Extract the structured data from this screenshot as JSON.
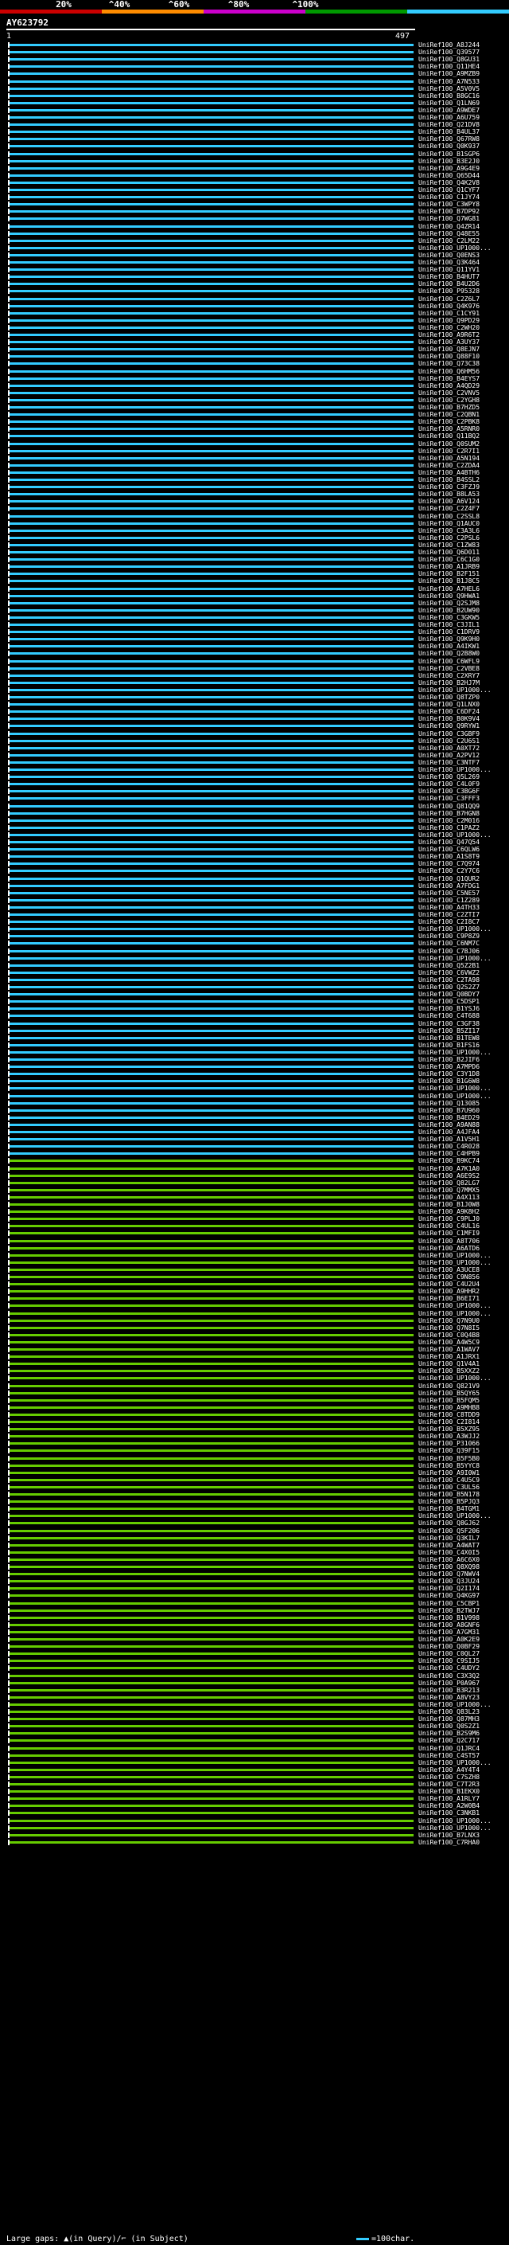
{
  "scale": {
    "ticks": [
      "20%",
      "^40%",
      "^60%",
      "^80%",
      "^100%"
    ],
    "colors": [
      "#cc0000",
      "#ff8c00",
      "#cc00cc",
      "#009900",
      "#33ccff"
    ]
  },
  "title": "AY623792",
  "query_start": "1",
  "query_end": "497",
  "colors": {
    "cyan": "#33ccff",
    "green": "#66cc00"
  },
  "hits": [
    {
      "label": "UniRef100_A8J244",
      "color": "cyan"
    },
    {
      "label": "UniRef100_Q39577",
      "color": "cyan"
    },
    {
      "label": "UniRef100_Q8GU31",
      "color": "cyan"
    },
    {
      "label": "UniRef100_Q11HE4",
      "color": "cyan"
    },
    {
      "label": "UniRef100_A9MZB9",
      "color": "cyan"
    },
    {
      "label": "UniRef100_A7N533",
      "color": "cyan"
    },
    {
      "label": "UniRef100_A5V0V5",
      "color": "cyan"
    },
    {
      "label": "UniRef100_B8GC16",
      "color": "cyan"
    },
    {
      "label": "UniRef100_Q1LN69",
      "color": "cyan"
    },
    {
      "label": "UniRef100_A9WDE7",
      "color": "cyan"
    },
    {
      "label": "UniRef100_A6U759",
      "color": "cyan"
    },
    {
      "label": "UniRef100_Q21DV8",
      "color": "cyan"
    },
    {
      "label": "UniRef100_B4UL37",
      "color": "cyan"
    },
    {
      "label": "UniRef100_Q67RW8",
      "color": "cyan"
    },
    {
      "label": "UniRef100_Q0K937",
      "color": "cyan"
    },
    {
      "label": "UniRef100_B1SGP6",
      "color": "cyan"
    },
    {
      "label": "UniRef100_B3E2J0",
      "color": "cyan"
    },
    {
      "label": "UniRef100_A9G4E9",
      "color": "cyan"
    },
    {
      "label": "UniRef100_Q65D44",
      "color": "cyan"
    },
    {
      "label": "UniRef100_Q4K2V8",
      "color": "cyan"
    },
    {
      "label": "UniRef100_Q1CYF7",
      "color": "cyan"
    },
    {
      "label": "UniRef100_C1JY74",
      "color": "cyan"
    },
    {
      "label": "UniRef100_C3WPY8",
      "color": "cyan"
    },
    {
      "label": "UniRef100_B7DP92",
      "color": "cyan"
    },
    {
      "label": "UniRef100_Q7WG81",
      "color": "cyan"
    },
    {
      "label": "UniRef100_Q4ZR14",
      "color": "cyan"
    },
    {
      "label": "UniRef100_Q48E55",
      "color": "cyan"
    },
    {
      "label": "UniRef100_C2LM22",
      "color": "cyan"
    },
    {
      "label": "UniRef100_UP1000...",
      "color": "cyan"
    },
    {
      "label": "UniRef100_Q0ENS3",
      "color": "cyan"
    },
    {
      "label": "UniRef100_Q3K464",
      "color": "cyan"
    },
    {
      "label": "UniRef100_Q11YV1",
      "color": "cyan"
    },
    {
      "label": "UniRef100_B4HUT7",
      "color": "cyan"
    },
    {
      "label": "UniRef100_B4U2D6",
      "color": "cyan"
    },
    {
      "label": "UniRef100_P95328",
      "color": "cyan"
    },
    {
      "label": "UniRef100_C2Z6L7",
      "color": "cyan"
    },
    {
      "label": "UniRef100_Q4K976",
      "color": "cyan"
    },
    {
      "label": "UniRef100_C1CY91",
      "color": "cyan"
    },
    {
      "label": "UniRef100_Q9PD29",
      "color": "cyan"
    },
    {
      "label": "UniRef100_C2WH20",
      "color": "cyan"
    },
    {
      "label": "UniRef100_A9R6T2",
      "color": "cyan"
    },
    {
      "label": "UniRef100_A3UY37",
      "color": "cyan"
    },
    {
      "label": "UniRef100_Q8EJN7",
      "color": "cyan"
    },
    {
      "label": "UniRef100_Q88F10",
      "color": "cyan"
    },
    {
      "label": "UniRef100_Q73C38",
      "color": "cyan"
    },
    {
      "label": "UniRef100_Q6HM56",
      "color": "cyan"
    },
    {
      "label": "UniRef100_B4EYS7",
      "color": "cyan"
    },
    {
      "label": "UniRef100_A4QD29",
      "color": "cyan"
    },
    {
      "label": "UniRef100_C2VNV5",
      "color": "cyan"
    },
    {
      "label": "UniRef100_C2YGH8",
      "color": "cyan"
    },
    {
      "label": "UniRef100_B7HZD5",
      "color": "cyan"
    },
    {
      "label": "UniRef100_C2QBN1",
      "color": "cyan"
    },
    {
      "label": "UniRef100_C2PBK8",
      "color": "cyan"
    },
    {
      "label": "UniRef100_A5RNR0",
      "color": "cyan"
    },
    {
      "label": "UniRef100_Q11BQ2",
      "color": "cyan"
    },
    {
      "label": "UniRef100_Q0SUM2",
      "color": "cyan"
    },
    {
      "label": "UniRef100_C2R7I1",
      "color": "cyan"
    },
    {
      "label": "UniRef100_A5N194",
      "color": "cyan"
    },
    {
      "label": "UniRef100_C2ZDA4",
      "color": "cyan"
    },
    {
      "label": "UniRef100_A4BTH6",
      "color": "cyan"
    },
    {
      "label": "UniRef100_B4SSL2",
      "color": "cyan"
    },
    {
      "label": "UniRef100_C3FZJ9",
      "color": "cyan"
    },
    {
      "label": "UniRef100_B8LA53",
      "color": "cyan"
    },
    {
      "label": "UniRef100_A6V124",
      "color": "cyan"
    },
    {
      "label": "UniRef100_C2Z4F7",
      "color": "cyan"
    },
    {
      "label": "UniRef100_C2SSL8",
      "color": "cyan"
    },
    {
      "label": "UniRef100_Q1AUC0",
      "color": "cyan"
    },
    {
      "label": "UniRef100_C3A3L6",
      "color": "cyan"
    },
    {
      "label": "UniRef100_C2PSL6",
      "color": "cyan"
    },
    {
      "label": "UniRef100_C1ZW83",
      "color": "cyan"
    },
    {
      "label": "UniRef100_Q6D011",
      "color": "cyan"
    },
    {
      "label": "UniRef100_C6C1G0",
      "color": "cyan"
    },
    {
      "label": "UniRef100_A1JRB9",
      "color": "cyan"
    },
    {
      "label": "UniRef100_B2F151",
      "color": "cyan"
    },
    {
      "label": "UniRef100_B1J8C5",
      "color": "cyan"
    },
    {
      "label": "UniRef100_A7HEL6",
      "color": "cyan"
    },
    {
      "label": "UniRef100_Q9HWA1",
      "color": "cyan"
    },
    {
      "label": "UniRef100_Q2SJM8",
      "color": "cyan"
    },
    {
      "label": "UniRef100_B2UW90",
      "color": "cyan"
    },
    {
      "label": "UniRef100_C3GKW5",
      "color": "cyan"
    },
    {
      "label": "UniRef100_C3JIL1",
      "color": "cyan"
    },
    {
      "label": "UniRef100_C1DRV9",
      "color": "cyan"
    },
    {
      "label": "UniRef100_Q9K9H0",
      "color": "cyan"
    },
    {
      "label": "UniRef100_A4IKW1",
      "color": "cyan"
    },
    {
      "label": "UniRef100_Q2B8W0",
      "color": "cyan"
    },
    {
      "label": "UniRef100_C6WFL9",
      "color": "cyan"
    },
    {
      "label": "UniRef100_C2VBE8",
      "color": "cyan"
    },
    {
      "label": "UniRef100_C2XRY7",
      "color": "cyan"
    },
    {
      "label": "UniRef100_B2HJ7M",
      "color": "cyan"
    },
    {
      "label": "UniRef100_UP1000...",
      "color": "cyan"
    },
    {
      "label": "UniRef100_Q8TZP0",
      "color": "cyan"
    },
    {
      "label": "UniRef100_Q1LNX0",
      "color": "cyan"
    },
    {
      "label": "UniRef100_C6DF24",
      "color": "cyan"
    },
    {
      "label": "UniRef100_B0K9V4",
      "color": "cyan"
    },
    {
      "label": "UniRef100_Q9RYW1",
      "color": "cyan"
    },
    {
      "label": "UniRef100_C3GBF9",
      "color": "cyan"
    },
    {
      "label": "UniRef100_C2U6S1",
      "color": "cyan"
    },
    {
      "label": "UniRef100_A0XT72",
      "color": "cyan"
    },
    {
      "label": "UniRef100_A2PV12",
      "color": "cyan"
    },
    {
      "label": "UniRef100_C3NTF7",
      "color": "cyan"
    },
    {
      "label": "UniRef100_UP1000...",
      "color": "cyan"
    },
    {
      "label": "UniRef100_Q5L269",
      "color": "cyan"
    },
    {
      "label": "UniRef100_C4L0F9",
      "color": "cyan"
    },
    {
      "label": "UniRef100_C3BG6F",
      "color": "cyan"
    },
    {
      "label": "UniRef100_C3FFF3",
      "color": "cyan"
    },
    {
      "label": "UniRef100_Q81QQ9",
      "color": "cyan"
    },
    {
      "label": "UniRef100_B7HGN8",
      "color": "cyan"
    },
    {
      "label": "UniRef100_C2M016",
      "color": "cyan"
    },
    {
      "label": "UniRef100_C1PAZ2",
      "color": "cyan"
    },
    {
      "label": "UniRef100_UP1000...",
      "color": "cyan"
    },
    {
      "label": "UniRef100_Q47Q54",
      "color": "cyan"
    },
    {
      "label": "UniRef100_C6QLW6",
      "color": "cyan"
    },
    {
      "label": "UniRef100_A1S8T9",
      "color": "cyan"
    },
    {
      "label": "UniRef100_C7Q974",
      "color": "cyan"
    },
    {
      "label": "UniRef100_C2Y7C6",
      "color": "cyan"
    },
    {
      "label": "UniRef100_Q1QUR2",
      "color": "cyan"
    },
    {
      "label": "UniRef100_A7FDG1",
      "color": "cyan"
    },
    {
      "label": "UniRef100_C5NE57",
      "color": "cyan"
    },
    {
      "label": "UniRef100_C1Z289",
      "color": "cyan"
    },
    {
      "label": "UniRef100_A4TH33",
      "color": "cyan"
    },
    {
      "label": "UniRef100_C2ZTI7",
      "color": "cyan"
    },
    {
      "label": "UniRef100_C2I8C7",
      "color": "cyan"
    },
    {
      "label": "UniRef100_UP1000...",
      "color": "cyan"
    },
    {
      "label": "UniRef100_C9P8Z9",
      "color": "cyan"
    },
    {
      "label": "UniRef100_C6NM7C",
      "color": "cyan"
    },
    {
      "label": "UniRef100_C7BJ06",
      "color": "cyan"
    },
    {
      "label": "UniRef100_UP1000...",
      "color": "cyan"
    },
    {
      "label": "UniRef100_Q5Z2B1",
      "color": "cyan"
    },
    {
      "label": "UniRef100_C6VWZ2",
      "color": "cyan"
    },
    {
      "label": "UniRef100_C2TA98",
      "color": "cyan"
    },
    {
      "label": "UniRef100_Q2S2Z7",
      "color": "cyan"
    },
    {
      "label": "UniRef100_Q0BDY7",
      "color": "cyan"
    },
    {
      "label": "UniRef100_C5DSP1",
      "color": "cyan"
    },
    {
      "label": "UniRef100_B1YSJ6",
      "color": "cyan"
    },
    {
      "label": "UniRef100_C4T688",
      "color": "cyan"
    },
    {
      "label": "UniRef100_C3GF38",
      "color": "cyan"
    },
    {
      "label": "UniRef100_B5ZI17",
      "color": "cyan"
    },
    {
      "label": "UniRef100_B1TEW8",
      "color": "cyan"
    },
    {
      "label": "UniRef100_B1FS16",
      "color": "cyan"
    },
    {
      "label": "UniRef100_UP1000...",
      "color": "cyan"
    },
    {
      "label": "UniRef100_B2JIF6",
      "color": "cyan"
    },
    {
      "label": "UniRef100_A7MPD6",
      "color": "cyan"
    },
    {
      "label": "UniRef100_C3Y1D8",
      "color": "cyan"
    },
    {
      "label": "UniRef100_B1G6W8",
      "color": "cyan"
    },
    {
      "label": "UniRef100_UP1000...",
      "color": "cyan"
    },
    {
      "label": "UniRef100_UP1000...",
      "color": "cyan"
    },
    {
      "label": "UniRef100_Q13085",
      "color": "cyan"
    },
    {
      "label": "UniRef100_B7U960",
      "color": "cyan"
    },
    {
      "label": "UniRef100_B4ED29",
      "color": "cyan"
    },
    {
      "label": "UniRef100_A9AN88",
      "color": "cyan"
    },
    {
      "label": "UniRef100_A4JFA4",
      "color": "cyan"
    },
    {
      "label": "UniRef100_A1V5H1",
      "color": "cyan"
    },
    {
      "label": "UniRef100_C4R028",
      "color": "cyan"
    },
    {
      "label": "UniRef100_C4HPB9",
      "color": "cyan"
    },
    {
      "label": "UniRef100_B9KC74",
      "color": "green"
    },
    {
      "label": "UniRef100_A7K1A0",
      "color": "green"
    },
    {
      "label": "UniRef100_A6E9S2",
      "color": "green"
    },
    {
      "label": "UniRef100_Q82LG7",
      "color": "green"
    },
    {
      "label": "UniRef100_Q7MMX5",
      "color": "green"
    },
    {
      "label": "UniRef100_A4X113",
      "color": "green"
    },
    {
      "label": "UniRef100_B1J0W8",
      "color": "green"
    },
    {
      "label": "UniRef100_A9K8H2",
      "color": "green"
    },
    {
      "label": "UniRef100_C9PLJ0",
      "color": "green"
    },
    {
      "label": "UniRef100_C4UL16",
      "color": "green"
    },
    {
      "label": "UniRef100_C1MFI9",
      "color": "green"
    },
    {
      "label": "UniRef100_A8T706",
      "color": "green"
    },
    {
      "label": "UniRef100_A6ATD6",
      "color": "green"
    },
    {
      "label": "UniRef100_UP1000...",
      "color": "green"
    },
    {
      "label": "UniRef100_UP1000...",
      "color": "green"
    },
    {
      "label": "UniRef100_A3UCE8",
      "color": "green"
    },
    {
      "label": "UniRef100_C9N856",
      "color": "green"
    },
    {
      "label": "UniRef100_C4U2U4",
      "color": "green"
    },
    {
      "label": "UniRef100_A9HHR2",
      "color": "green"
    },
    {
      "label": "UniRef100_B6EI71",
      "color": "green"
    },
    {
      "label": "UniRef100_UP1000...",
      "color": "green"
    },
    {
      "label": "UniRef100_UP1000...",
      "color": "green"
    },
    {
      "label": "UniRef100_Q7N9U0",
      "color": "green"
    },
    {
      "label": "UniRef100_Q7N8I5",
      "color": "green"
    },
    {
      "label": "UniRef100_C0Q4B8",
      "color": "green"
    },
    {
      "label": "UniRef100_A4W5C9",
      "color": "green"
    },
    {
      "label": "UniRef100_A1WAV7",
      "color": "green"
    },
    {
      "label": "UniRef100_A1JRX1",
      "color": "green"
    },
    {
      "label": "UniRef100_Q1V4A1",
      "color": "green"
    },
    {
      "label": "UniRef100_B5XXZ2",
      "color": "green"
    },
    {
      "label": "UniRef100_UP1000...",
      "color": "green"
    },
    {
      "label": "UniRef100_Q821V9",
      "color": "green"
    },
    {
      "label": "UniRef100_B5QY65",
      "color": "green"
    },
    {
      "label": "UniRef100_B5FQM5",
      "color": "green"
    },
    {
      "label": "UniRef100_A9MHB8",
      "color": "green"
    },
    {
      "label": "UniRef100_C8TDD9",
      "color": "green"
    },
    {
      "label": "UniRef100_C2I814",
      "color": "green"
    },
    {
      "label": "UniRef100_B5XZ95",
      "color": "green"
    },
    {
      "label": "UniRef100_A3WJJ2",
      "color": "green"
    },
    {
      "label": "UniRef100_P31066",
      "color": "green"
    },
    {
      "label": "UniRef100_Q39F15",
      "color": "green"
    },
    {
      "label": "UniRef100_B5F5B0",
      "color": "green"
    },
    {
      "label": "UniRef100_B5YYC8",
      "color": "green"
    },
    {
      "label": "UniRef100_A9I0W1",
      "color": "green"
    },
    {
      "label": "UniRef100_C4U5C9",
      "color": "green"
    },
    {
      "label": "UniRef100_C3UL56",
      "color": "green"
    },
    {
      "label": "UniRef100_B5N178",
      "color": "green"
    },
    {
      "label": "UniRef100_B5PJQ3",
      "color": "green"
    },
    {
      "label": "UniRef100_B4TGM1",
      "color": "green"
    },
    {
      "label": "UniRef100_UP1000...",
      "color": "green"
    },
    {
      "label": "UniRef100_Q8GJ62",
      "color": "green"
    },
    {
      "label": "UniRef100_Q5F206",
      "color": "green"
    },
    {
      "label": "UniRef100_Q3KIL7",
      "color": "green"
    },
    {
      "label": "UniRef100_A4WAT7",
      "color": "green"
    },
    {
      "label": "UniRef100_C4X0I5",
      "color": "green"
    },
    {
      "label": "UniRef100_A6C6X0",
      "color": "green"
    },
    {
      "label": "UniRef100_Q8XQ98",
      "color": "green"
    },
    {
      "label": "UniRef100_Q7NWV4",
      "color": "green"
    },
    {
      "label": "UniRef100_Q3JU24",
      "color": "green"
    },
    {
      "label": "UniRef100_Q2I174",
      "color": "green"
    },
    {
      "label": "UniRef100_Q4KG97",
      "color": "green"
    },
    {
      "label": "UniRef100_C5CBP1",
      "color": "green"
    },
    {
      "label": "UniRef100_B2TWJ7",
      "color": "green"
    },
    {
      "label": "UniRef100_B1V998",
      "color": "green"
    },
    {
      "label": "UniRef100_A8GNF6",
      "color": "green"
    },
    {
      "label": "UniRef100_A7GM31",
      "color": "green"
    },
    {
      "label": "UniRef100_A0K2E9",
      "color": "green"
    },
    {
      "label": "UniRef100_Q0BF29",
      "color": "green"
    },
    {
      "label": "UniRef100_C0QL27",
      "color": "green"
    },
    {
      "label": "UniRef100_C9SIJ5",
      "color": "green"
    },
    {
      "label": "UniRef100_C4UDY2",
      "color": "green"
    },
    {
      "label": "UniRef100_C3X3Q2",
      "color": "green"
    },
    {
      "label": "UniRef100_P0A967",
      "color": "green"
    },
    {
      "label": "UniRef100_B3R213",
      "color": "green"
    },
    {
      "label": "UniRef100_A8VY23",
      "color": "green"
    },
    {
      "label": "UniRef100_UP1000...",
      "color": "green"
    },
    {
      "label": "UniRef100_Q83L23",
      "color": "green"
    },
    {
      "label": "UniRef100_Q87MH3",
      "color": "green"
    },
    {
      "label": "UniRef100_Q0S2Z1",
      "color": "green"
    },
    {
      "label": "UniRef100_B2S9M6",
      "color": "green"
    },
    {
      "label": "UniRef100_Q2C717",
      "color": "green"
    },
    {
      "label": "UniRef100_Q1JRC4",
      "color": "green"
    },
    {
      "label": "UniRef100_C4ST57",
      "color": "green"
    },
    {
      "label": "UniRef100_UP1000...",
      "color": "green"
    },
    {
      "label": "UniRef100_A4Y4T4",
      "color": "green"
    },
    {
      "label": "UniRef100_C7SZH8",
      "color": "green"
    },
    {
      "label": "UniRef100_C7T2R3",
      "color": "green"
    },
    {
      "label": "UniRef100_B1EKX0",
      "color": "green"
    },
    {
      "label": "UniRef100_A1RLY7",
      "color": "green"
    },
    {
      "label": "UniRef100_A2W0B4",
      "color": "green"
    },
    {
      "label": "UniRef100_C3NKB1",
      "color": "green"
    },
    {
      "label": "UniRef100_UP1000...",
      "color": "green"
    },
    {
      "label": "UniRef100_UP1000...",
      "color": "green"
    },
    {
      "label": "UniRef100_B7LNX3",
      "color": "green"
    },
    {
      "label": "UniRef100_C7RHA0",
      "color": "green"
    }
  ],
  "footer": {
    "gaps_text": "Large gaps: ▲(in Query)/⌐ (in Subject)",
    "legend_text": "=100char."
  }
}
